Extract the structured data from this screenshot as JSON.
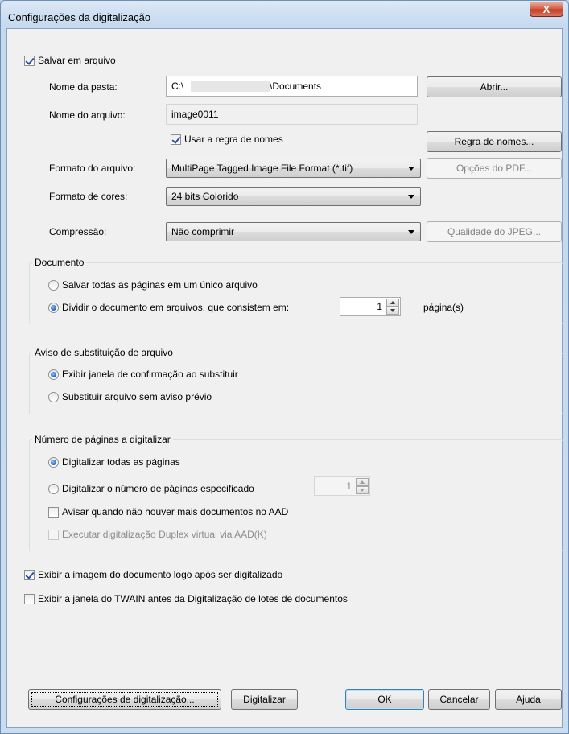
{
  "window": {
    "title": "Configurações da digitalização",
    "close_glyph": "X"
  },
  "save_section": {
    "save_to_file_label": "Salvar em arquivo",
    "folder_label": "Nome da pasta:",
    "folder_value_prefix": "C:\\",
    "folder_value_suffix": "\\Documents",
    "open_button": "Abrir...",
    "filename_label": "Nome do arquivo:",
    "filename_value": "image0011",
    "use_naming_rule_label": "Usar a regra de nomes",
    "naming_rule_button": "Regra de nomes...",
    "format_label": "Formato do arquivo:",
    "format_value": "MultiPage Tagged Image File Format (*.tif)",
    "pdf_options_button": "Opções do PDF...",
    "color_label": "Formato de cores:",
    "color_value": "24 bits Colorido",
    "compression_label": "Compressão:",
    "compression_value": "Não comprimir",
    "jpeg_quality_button": "Qualidade do JPEG..."
  },
  "document_group": {
    "title": "Documento",
    "option_single": "Salvar todas as páginas em um único arquivo",
    "option_split": "Dividir o documento em arquivos, que consistem em:",
    "pages_value": "1",
    "pages_unit": "página(s)"
  },
  "overwrite_group": {
    "title": "Aviso de substituição de arquivo",
    "option_confirm": "Exibir janela de confirmação ao substituir",
    "option_replace": "Substituir arquivo sem aviso prévio"
  },
  "pages_group": {
    "title": "Número de páginas a digitalizar",
    "option_all": "Digitalizar todas as páginas",
    "option_specified": "Digitalizar o número de páginas especificado",
    "specified_value": "1",
    "warn_no_docs": "Avisar quando não houver mais documentos no AAD",
    "duplex_virtual": "Executar digitalização Duplex virtual via AAD(K)"
  },
  "options": {
    "show_image": "Exibir a imagem do documento logo após ser digitalizado",
    "show_twain": "Exibir a janela do TWAIN antes da Digitalização de lotes de documentos"
  },
  "buttons": {
    "scan_settings": "Configurações de digitalização...",
    "scan": "Digitalizar",
    "ok": "OK",
    "cancel": "Cancelar",
    "help": "Ajuda"
  }
}
